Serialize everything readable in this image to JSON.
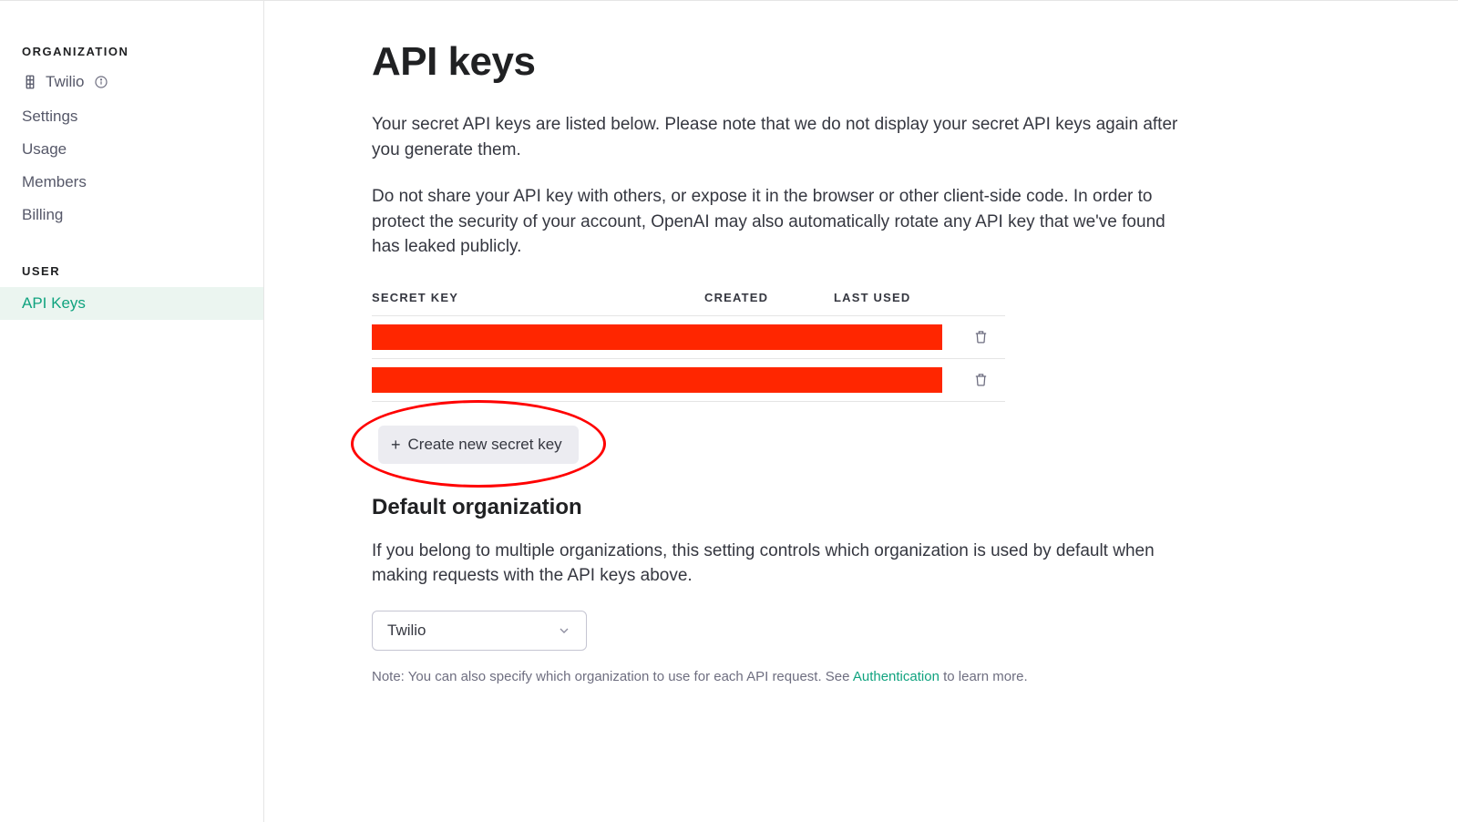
{
  "sidebar": {
    "org_heading": "ORGANIZATION",
    "org_name": "Twilio",
    "items": [
      {
        "label": "Settings"
      },
      {
        "label": "Usage"
      },
      {
        "label": "Members"
      },
      {
        "label": "Billing"
      }
    ],
    "user_heading": "USER",
    "user_items": [
      {
        "label": "API Keys"
      }
    ]
  },
  "page": {
    "title": "API keys",
    "intro1": "Your secret API keys are listed below. Please note that we do not display your secret API keys again after you generate them.",
    "intro2": "Do not share your API key with others, or expose it in the browser or other client-side code. In order to protect the security of your account, OpenAI may also automatically rotate any API key that we've found has leaked publicly."
  },
  "table": {
    "headers": {
      "secret": "SECRET KEY",
      "created": "CREATED",
      "last_used": "LAST USED"
    },
    "rows": [
      {
        "redacted": true
      },
      {
        "redacted": true
      }
    ]
  },
  "create_button": "Create new secret key",
  "default_org": {
    "heading": "Default organization",
    "para": "If you belong to multiple organizations, this setting controls which organization is used by default when making requests with the API keys above.",
    "selected": "Twilio",
    "note_prefix": "Note: You can also specify which organization to use for each API request. See ",
    "note_link": "Authentication",
    "note_suffix": " to learn more."
  }
}
